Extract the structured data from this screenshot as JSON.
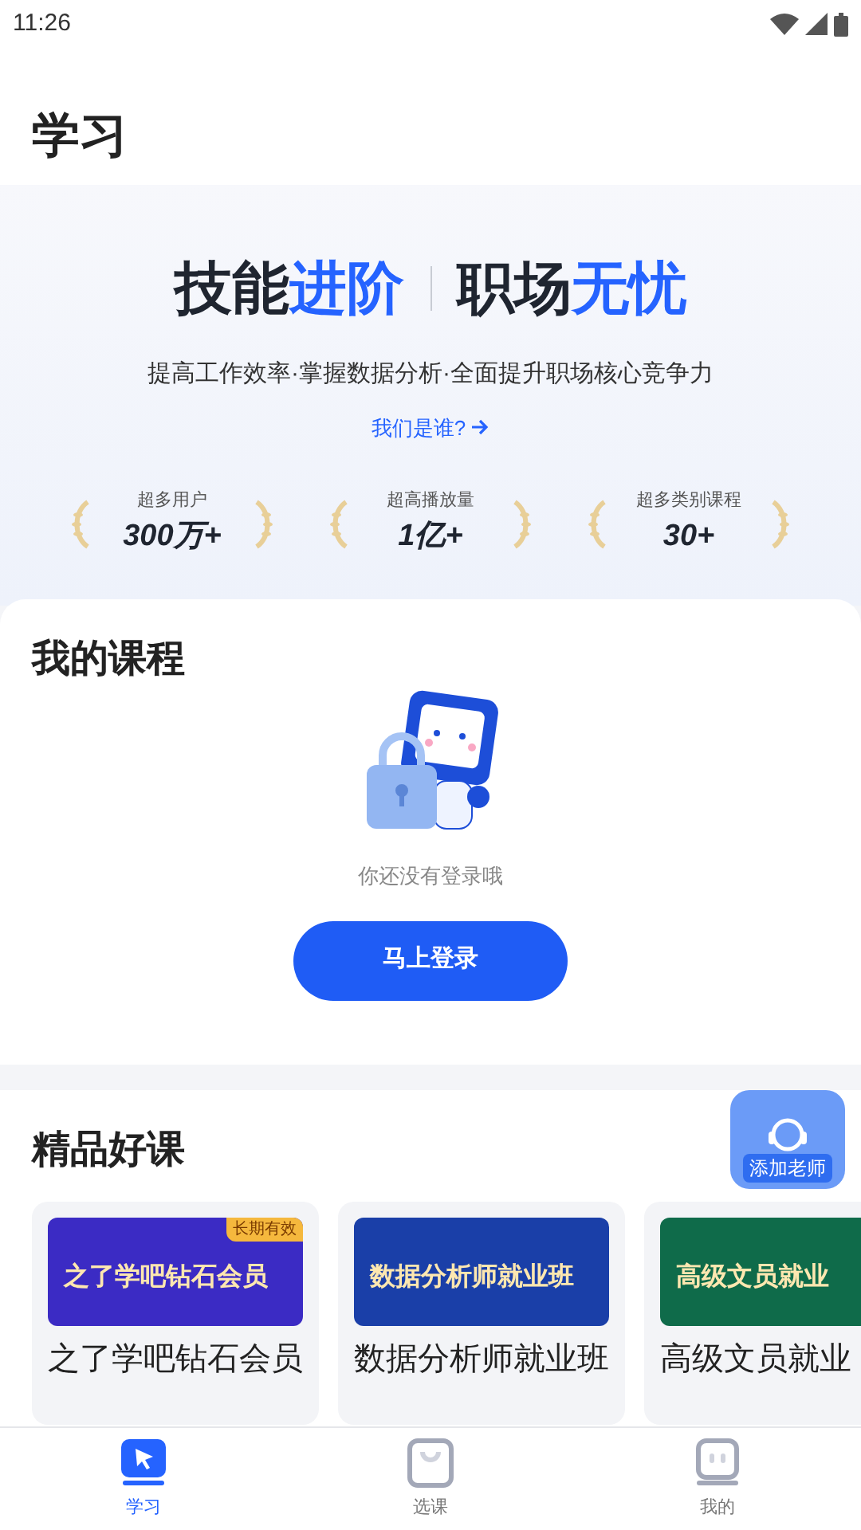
{
  "status_bar": {
    "time": "11:26"
  },
  "header": {
    "title": "学习"
  },
  "hero": {
    "title_parts": [
      {
        "text": "技能",
        "highlight": false
      },
      {
        "text": "进阶",
        "highlight": true
      }
    ],
    "title_parts_2": [
      {
        "text": "职场",
        "highlight": false
      },
      {
        "text": "无忧",
        "highlight": true
      }
    ],
    "subtitle": "提高工作效率·掌握数据分析·全面提升职场核心竞争力",
    "link": "我们是谁?",
    "stats": [
      {
        "label": "超多用户",
        "value": "300万+"
      },
      {
        "label": "超高播放量",
        "value": "1亿+"
      },
      {
        "label": "超多类别课程",
        "value": "30+"
      }
    ]
  },
  "my_courses": {
    "title": "我的课程",
    "empty_text": "你还没有登录哦",
    "login_button": "马上登录"
  },
  "featured": {
    "title": "精品好课",
    "float_badge": "添加老师",
    "courses": [
      {
        "banner_title": "之了学吧钻石会员",
        "ribbon": "长期有效",
        "color": "#3b2bc4",
        "title": "之了学吧钻石会员"
      },
      {
        "banner_title": "数据分析师就业班",
        "color": "#1a3fa8",
        "title": "数据分析师就业班"
      },
      {
        "banner_title": "高级文员就业",
        "color": "#0f6b4a",
        "title": "高级文员就业"
      }
    ]
  },
  "tab_bar": [
    {
      "label": "学习",
      "selected": true,
      "kind": "learn"
    },
    {
      "label": "选课",
      "selected": false,
      "kind": "shop"
    },
    {
      "label": "我的",
      "selected": false,
      "kind": "me"
    }
  ]
}
